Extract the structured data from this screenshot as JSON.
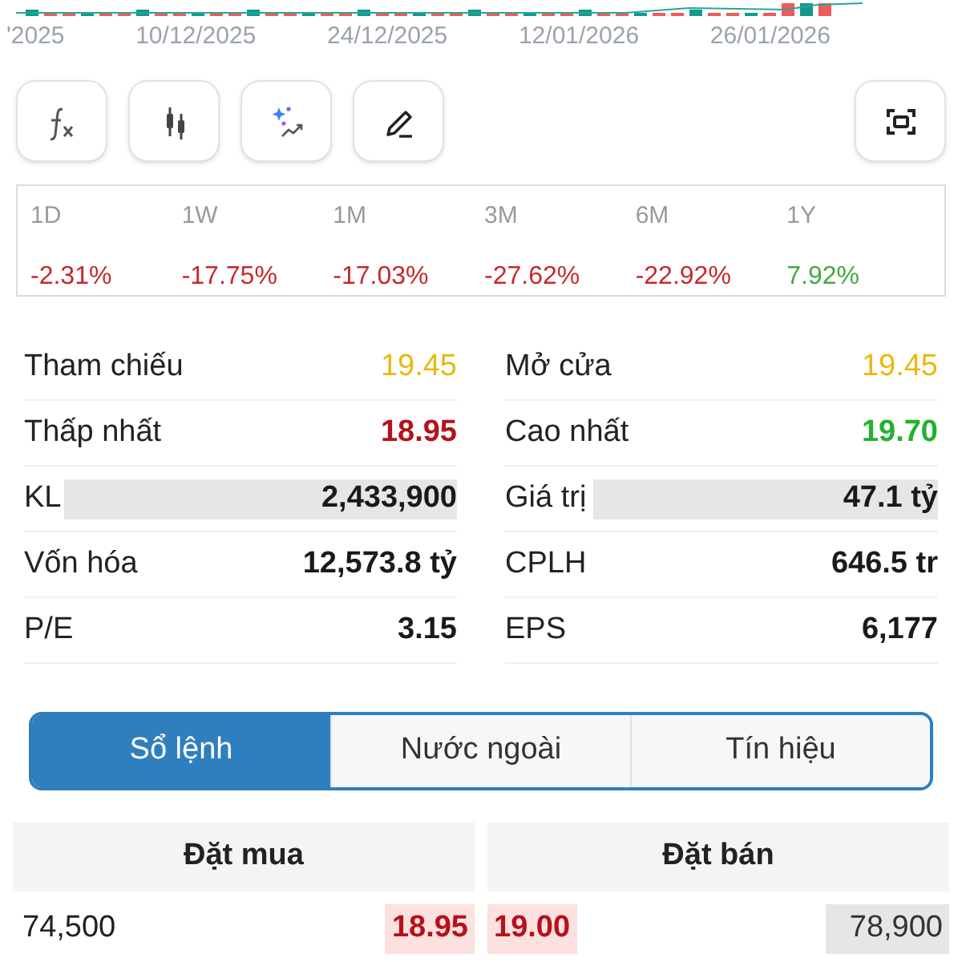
{
  "chart_axis": {
    "dates": [
      "'2025",
      "10/12/2025",
      "24/12/2025",
      "12/01/2026",
      "26/01/2026"
    ]
  },
  "toolbar": {
    "tools": [
      {
        "kind": "formula"
      },
      {
        "kind": "candles"
      },
      {
        "kind": "ai"
      },
      {
        "kind": "draw"
      }
    ],
    "fullscreen": {
      "kind": "fullscreen"
    }
  },
  "performance": [
    {
      "period": "1D",
      "change": "-2.31%",
      "color": "#c62828"
    },
    {
      "period": "1W",
      "change": "-17.75%",
      "color": "#c62828"
    },
    {
      "period": "1M",
      "change": "-17.03%",
      "color": "#c62828"
    },
    {
      "period": "3M",
      "change": "-27.62%",
      "color": "#c62828"
    },
    {
      "period": "6M",
      "change": "-22.92%",
      "color": "#c62828"
    },
    {
      "period": "1Y",
      "change": "7.92%",
      "color": "#43a843"
    }
  ],
  "stats": [
    {
      "label": "Tham chiếu",
      "value": "19.45",
      "color": "#e8b90e"
    },
    {
      "label": "Mở cửa",
      "value": "19.45",
      "color": "#e8b90e"
    },
    {
      "label": "Thấp nhất",
      "value": "18.95",
      "color": "#b5121b"
    },
    {
      "label": "Cao nhất",
      "value": "19.70",
      "color": "#22b22e"
    },
    {
      "label": "KL",
      "value": "2,433,900",
      "color": "#1a1a1a"
    },
    {
      "label": "Giá trị",
      "value": "47.1 tỷ",
      "color": "#1a1a1a"
    },
    {
      "label": "Vốn hóa",
      "value": "12,573.8 tỷ",
      "color": "#1a1a1a"
    },
    {
      "label": "CPLH",
      "value": "646.5 tr",
      "color": "#1a1a1a"
    },
    {
      "label": "P/E",
      "value": "3.15",
      "color": "#1a1a1a"
    },
    {
      "label": "EPS",
      "value": "6,177",
      "color": "#1a1a1a"
    }
  ],
  "tabs": [
    {
      "label": "Sổ lệnh",
      "selected": true
    },
    {
      "label": "Nước ngoài",
      "selected": false
    },
    {
      "label": "Tín hiệu",
      "selected": false
    }
  ],
  "order_book": {
    "headers": [
      "Đặt mua",
      "Đặt bán"
    ],
    "rows": [
      {
        "bid_volume": "74,500",
        "bid_price": "18.95",
        "ask_price": "19.00",
        "ask_volume": "78,900"
      }
    ]
  }
}
